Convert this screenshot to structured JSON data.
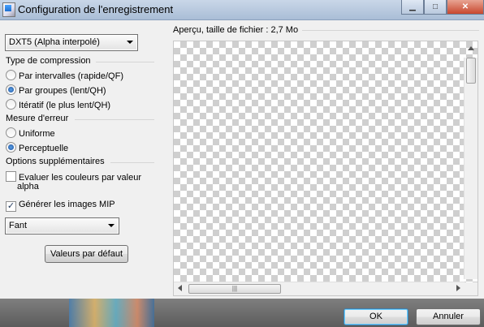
{
  "window": {
    "title": "Configuration de l'enregistrement",
    "minimize": "▁",
    "maximize": "□",
    "close": "✕"
  },
  "format": {
    "selected": "DXT5 (Alpha interpolé)"
  },
  "compression": {
    "label": "Type de compression",
    "options": [
      "Par intervalles (rapide/QF)",
      "Par groupes (lent/QH)",
      "Itératif (le plus lent/QH)"
    ],
    "selected_index": 1
  },
  "error_measure": {
    "label": "Mesure d'erreur",
    "options": [
      "Uniforme",
      "Perceptuelle"
    ],
    "selected_index": 1
  },
  "extra": {
    "label": "Options supplémentaires",
    "alpha_weight": {
      "label_line1": "Evaluer les couleurs par valeur",
      "label_line2": "alpha",
      "checked": false
    },
    "mipmaps": {
      "label": "Générer les images MIP",
      "checked": true
    }
  },
  "filter": {
    "selected": "Fant"
  },
  "defaults_button": "Valeurs par défaut",
  "preview": {
    "label": "Aperçu, taille de fichier : 2,7 Mo"
  },
  "ok_button": "OK",
  "cancel_button": "Annuler"
}
